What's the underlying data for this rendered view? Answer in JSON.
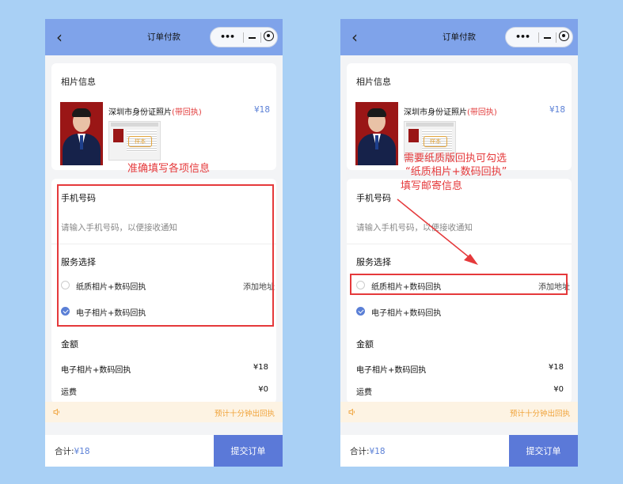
{
  "phones": [
    {
      "nav": {
        "title": "订单付款",
        "back": "‹",
        "more": "•••"
      },
      "photo_section": {
        "title": "相片信息",
        "product_name": "深圳市身份证照片",
        "product_tag": "(带回执)",
        "price": "¥18",
        "stamp": "样本"
      },
      "form": {
        "phone_label": "手机号码",
        "phone_placeholder": "请输入手机号码，以便接收通知",
        "service_label": "服务选择",
        "options": [
          {
            "label": "纸质相片+数码回执",
            "link": "添加地址",
            "checked": false
          },
          {
            "label": "电子相片+数码回执",
            "checked": true
          }
        ]
      },
      "amount": {
        "title": "金额",
        "rows": [
          {
            "label": "电子相片+数码回执",
            "value": "¥18"
          },
          {
            "label": "运费",
            "value": "¥0"
          }
        ]
      },
      "notice": "预计十分钟出回执",
      "footer": {
        "total_label": "合计:",
        "total_value": "¥18",
        "submit": "提交订单"
      }
    },
    {
      "nav": {
        "title": "订单付款",
        "back": "‹",
        "more": "•••"
      },
      "photo_section": {
        "title": "相片信息",
        "product_name": "深圳市身份证照片",
        "product_tag": "(带回执)",
        "price": "¥18",
        "stamp": "样本"
      },
      "form": {
        "phone_label": "手机号码",
        "phone_placeholder": "请输入手机号码，以便接收通知",
        "service_label": "服务选择",
        "options": [
          {
            "label": "纸质相片+数码回执",
            "link": "添加地址",
            "checked": false
          },
          {
            "label": "电子相片+数码回执",
            "checked": true
          }
        ]
      },
      "amount": {
        "title": "金额",
        "rows": [
          {
            "label": "电子相片+数码回执",
            "value": "¥18"
          },
          {
            "label": "运费",
            "value": "¥0"
          }
        ]
      },
      "notice": "预计十分钟出回执",
      "footer": {
        "total_label": "合计:",
        "total_value": "¥18",
        "submit": "提交订单"
      }
    }
  ],
  "annotations": {
    "left": "准确填写各项信息",
    "right_line1": "需要纸质版回执可勾选",
    "right_line2": "“纸质相片+数码回执”",
    "right_line3": "填写邮寄信息",
    "color": "#e5393b"
  }
}
